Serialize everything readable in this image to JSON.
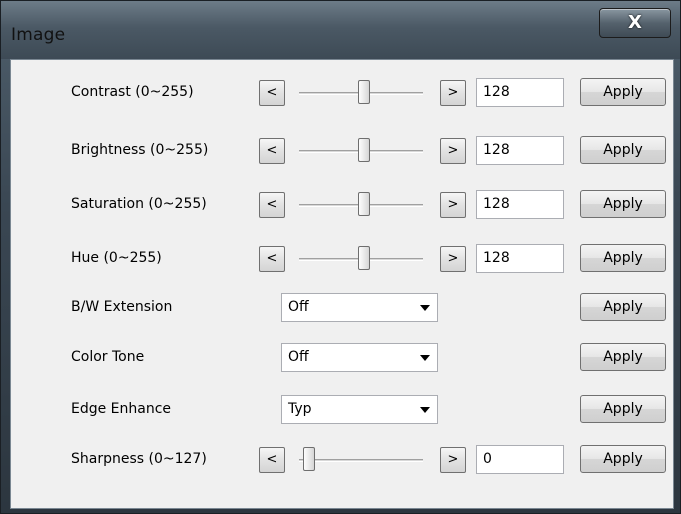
{
  "window": {
    "title": "Image",
    "close_glyph": "X"
  },
  "slider_rows": [
    {
      "label": "Contrast (0~255)",
      "dec": "<",
      "inc": ">",
      "value": "128",
      "level_fraction": 0.5,
      "apply": "Apply"
    },
    {
      "label": "Brightness (0~255)",
      "dec": "<",
      "inc": ">",
      "value": "128",
      "level_fraction": 0.5,
      "apply": "Apply"
    },
    {
      "label": "Saturation (0~255)",
      "dec": "<",
      "inc": ">",
      "value": "128",
      "level_fraction": 0.5,
      "apply": "Apply"
    },
    {
      "label": "Hue (0~255)",
      "dec": "<",
      "inc": ">",
      "value": "128",
      "level_fraction": 0.5,
      "apply": "Apply"
    }
  ],
  "select_rows": [
    {
      "label": "B/W Extension",
      "selected": "Off",
      "apply": "Apply"
    },
    {
      "label": "Color Tone",
      "selected": "Off",
      "apply": "Apply"
    },
    {
      "label": "Edge Enhance",
      "selected": "Typ",
      "apply": "Apply"
    }
  ],
  "sharpness": {
    "label": "Sharpness (0~127)",
    "dec": "<",
    "inc": ">",
    "value": "0",
    "level_fraction": 0.0,
    "apply": "Apply"
  }
}
